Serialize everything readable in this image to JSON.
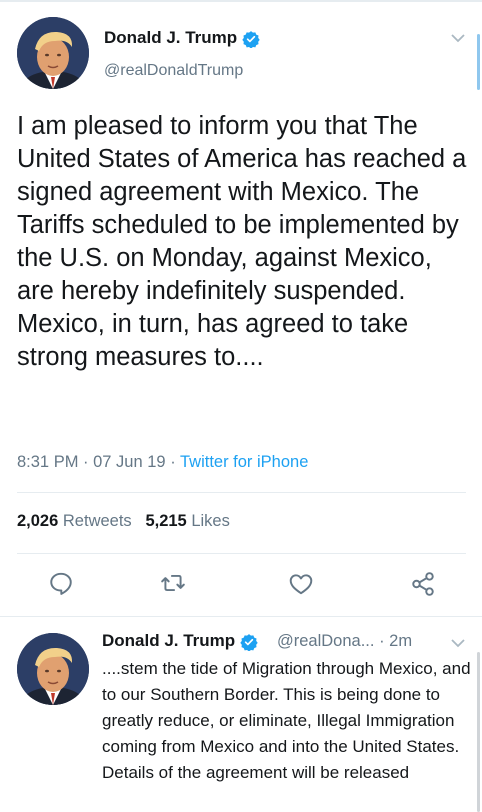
{
  "tweet": {
    "author_name": "Donald J. Trump",
    "author_handle": "@realDonaldTrump",
    "text": "I am pleased to inform you that The United States of America has reached a signed agreement with Mexico. The Tariffs scheduled to be implemented by the U.S. on Monday, against Mexico, are hereby indefinitely suspended. Mexico, in turn, has agreed to take strong measures to....",
    "time": "8:31 PM",
    "date": "07 Jun 19",
    "separator": " · ",
    "source": "Twitter for iPhone",
    "retweets_count": "2,026",
    "retweets_label": "Retweets",
    "likes_count": "5,215",
    "likes_label": "Likes"
  },
  "reply": {
    "author_name": "Donald J. Trump",
    "author_handle": "@realDona...",
    "age": "· 2m",
    "text": "....stem the tide of Migration through Mexico, and to our Southern Border. This is being done to greatly reduce, or eliminate, Illegal Immigration coming from Mexico and into the United States. Details of the agreement will be released"
  },
  "icons": {
    "verified": "verified-badge-icon",
    "reply": "reply-icon",
    "retweet": "retweet-icon",
    "like": "heart-icon",
    "share": "share-icon",
    "menu": "chevron-down-icon"
  },
  "colors": {
    "accent": "#1da1f2",
    "secondary_text": "#657786",
    "divider": "#e6ecf0"
  }
}
